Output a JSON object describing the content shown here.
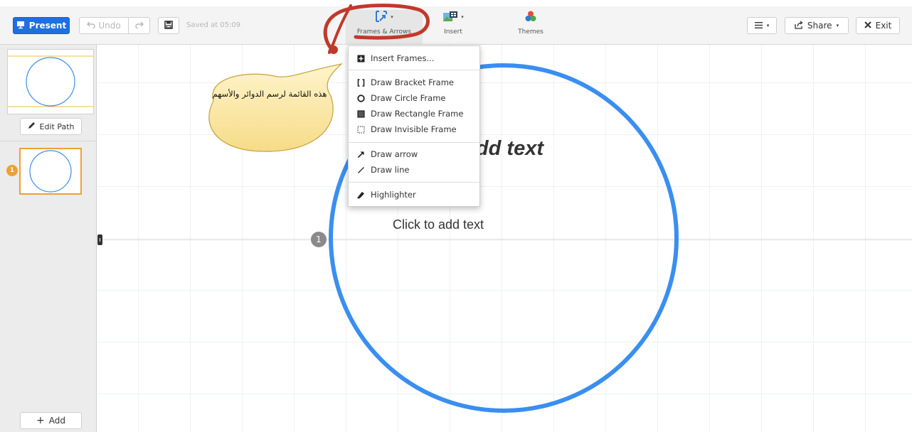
{
  "toolbar": {
    "present_label": "Present",
    "undo_label": "Undo",
    "saved_text": "Saved at 05:09",
    "frames_label": "Frames & Arrows",
    "insert_label": "Insert",
    "themes_label": "Themes",
    "share_label": "Share",
    "exit_label": "Exit"
  },
  "sidebar": {
    "edit_path_label": "Edit Path",
    "path_step_number": "1",
    "add_label": "Add"
  },
  "canvas": {
    "title_placeholder": "Click to add text",
    "body_placeholder": "Click to add text",
    "frame_number": "1",
    "circle_color": "#3a8ef0"
  },
  "dropdown": {
    "items": [
      {
        "label": "Insert Frames...",
        "icon": "insert-frame-icon"
      },
      {
        "label": "Draw Bracket Frame",
        "icon": "bracket-icon"
      },
      {
        "label": "Draw Circle Frame",
        "icon": "circle-icon"
      },
      {
        "label": "Draw Rectangle Frame",
        "icon": "rectangle-icon"
      },
      {
        "label": "Draw Invisible Frame",
        "icon": "invisible-frame-icon"
      },
      {
        "label": "Draw arrow",
        "icon": "arrow-icon"
      },
      {
        "label": "Draw line",
        "icon": "line-icon"
      },
      {
        "label": "Highlighter",
        "icon": "highlighter-icon"
      }
    ]
  },
  "annotation": {
    "text": "هذه القائمة لرسم الدوائر والأسهم"
  },
  "colors": {
    "accent": "#1f6fe0",
    "path_highlight": "#f0a030",
    "annotation_fill": "#fbe7a6",
    "scribble": "#c0392b"
  }
}
